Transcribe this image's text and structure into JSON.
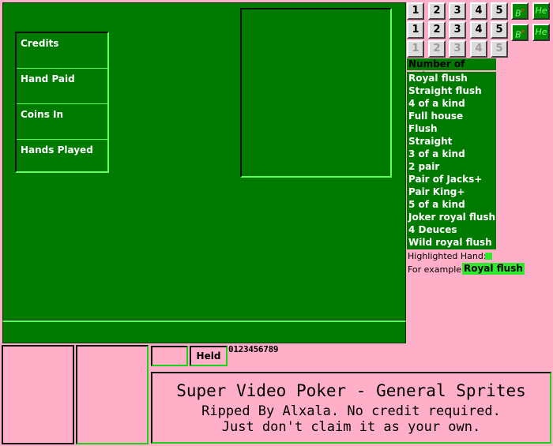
{
  "stats": {
    "labels": [
      "Credits",
      "Hand Paid",
      "Coins In",
      "Hands Played"
    ]
  },
  "buttons": {
    "row1": [
      "1",
      "2",
      "3",
      "4",
      "5"
    ],
    "row2": [
      "1",
      "2",
      "3",
      "4",
      "5"
    ],
    "row3_disabled": [
      "1",
      "2",
      "3",
      "4",
      "5"
    ],
    "bet_label": "B",
    "bet_sub": "P",
    "help_label": "He"
  },
  "paytable": {
    "header": "Number of Coins",
    "hands": [
      "Royal flush",
      "Straight flush",
      "4 of a kind",
      "Full house",
      "Flush",
      "Straight",
      "3 of a kind",
      "2 pair",
      "Pair of Jacks+",
      "Pair King+",
      "5 of a kind",
      "Joker royal flush",
      "4 Deuces",
      "Wild royal flush"
    ],
    "highlight_label": "Highlighted Hand:",
    "example_label": "For example:",
    "example_value": "Royal flush",
    "highlight_color": "#2ee82e"
  },
  "held_label": "Held",
  "digits": "0123456789",
  "credits": {
    "title": "Super Video Poker - General Sprites",
    "line1": "Ripped By Alxala. No credit required.",
    "line2": "Just don't claim it as your own."
  },
  "colors": {
    "felt": "#007a00",
    "background": "#ffb0c8",
    "accent": "#5cff5c"
  }
}
